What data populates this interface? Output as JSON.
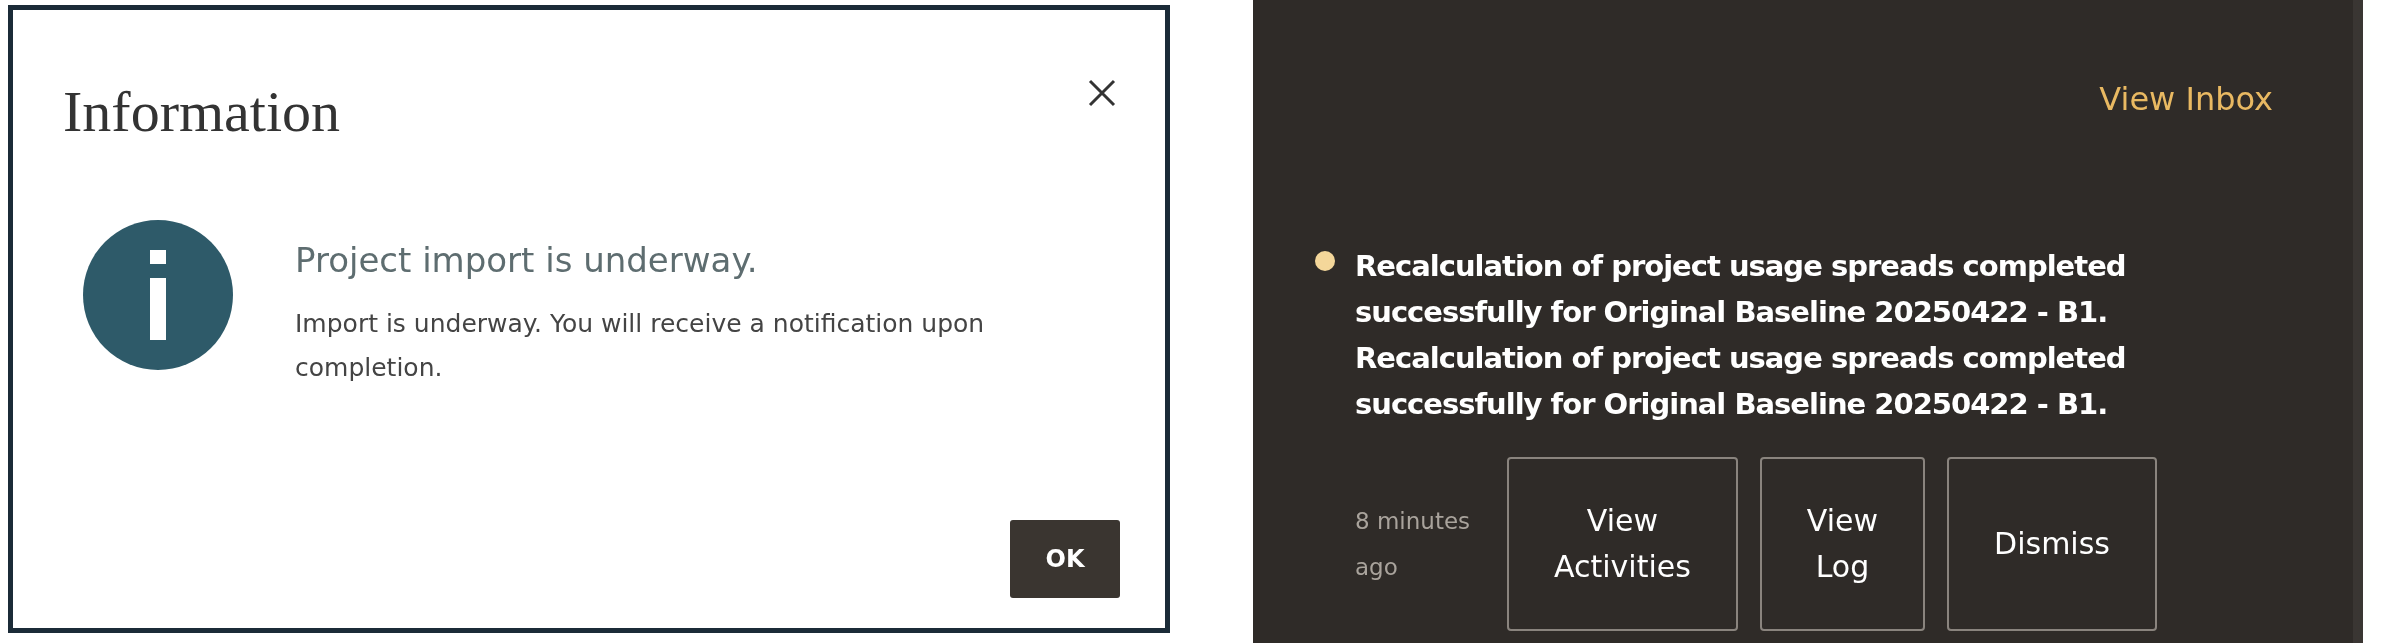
{
  "dialog": {
    "title": "Information",
    "heading": "Project import is underway.",
    "message": "Import is underway. You will receive a notification upon completion.",
    "button": "OK"
  },
  "notifications": {
    "link": "View Inbox",
    "items": [
      {
        "unread": true,
        "message": "Recalculation of project usage spreads completed successfully for Original Baseline 20250422 - B1. Recalculation of project usage spreads completed successfully for Original Baseline 20250422 - B1.",
        "time": "8 minutes ago",
        "actions": [
          "View Activities",
          "View Log",
          "Dismiss"
        ]
      }
    ]
  }
}
